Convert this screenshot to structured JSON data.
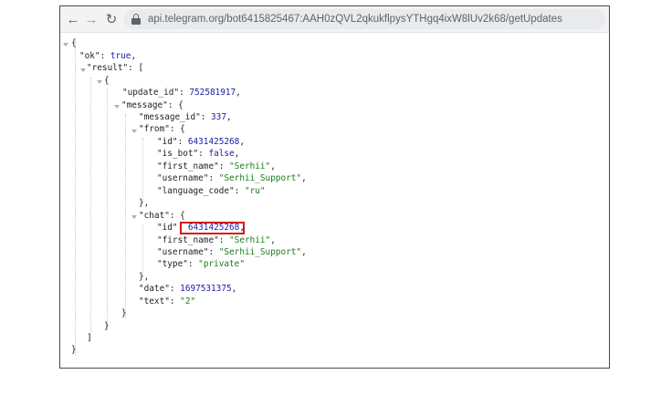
{
  "browser": {
    "back_icon": "arrow-left-icon",
    "forward_icon": "arrow-right-icon",
    "reload_icon": "reload-icon",
    "url": "api.telegram.org/bot6415825467:AAH0zQVL2qkukflpysYTHgq4ixW8lUv2k68/getUpdates"
  },
  "json": {
    "open_root": "{",
    "ok_key": "\"ok\"",
    "ok_val": "true",
    "result_key": "\"result\"",
    "open_result": "[",
    "open_item": "{",
    "update_id_key": "\"update_id\"",
    "update_id_val": "752581917",
    "message_key": "\"message\"",
    "open_message": "{",
    "message_id_key": "\"message_id\"",
    "message_id_val": "337",
    "from_key": "\"from\"",
    "open_from": "{",
    "from_id_key": "\"id\"",
    "from_id_val": "6431425268",
    "is_bot_key": "\"is_bot\"",
    "is_bot_val": "false",
    "first_name_key": "\"first_name\"",
    "first_name_val": "\"Serhii\"",
    "username_key": "\"username\"",
    "username_val": "\"Serhii_Support\"",
    "language_code_key": "\"language_code\"",
    "language_code_val": "\"ru\"",
    "close_from": "},",
    "chat_key": "\"chat\"",
    "open_chat": "{",
    "chat_id_key": "\"id\"",
    "chat_id_val": "6431425268",
    "chat_first_name_key": "\"first_name\"",
    "chat_first_name_val": "\"Serhii\"",
    "chat_username_key": "\"username\"",
    "chat_username_val": "\"Serhii_Support\"",
    "type_key": "\"type\"",
    "type_val": "\"private\"",
    "close_chat": "},",
    "date_key": "\"date\"",
    "date_val": "1697531375",
    "text_key": "\"text\"",
    "text_val": "\"2\"",
    "close_message": "}",
    "close_item": "}",
    "close_result": "]",
    "close_root": "}"
  }
}
